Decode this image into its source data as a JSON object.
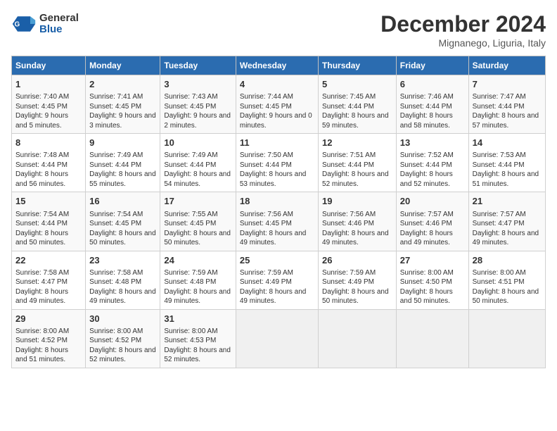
{
  "header": {
    "logo_line1": "General",
    "logo_line2": "Blue",
    "month": "December 2024",
    "location": "Mignanego, Liguria, Italy"
  },
  "days_of_week": [
    "Sunday",
    "Monday",
    "Tuesday",
    "Wednesday",
    "Thursday",
    "Friday",
    "Saturday"
  ],
  "weeks": [
    [
      {
        "day": "1",
        "rise": "Sunrise: 7:40 AM",
        "set": "Sunset: 4:45 PM",
        "daylight": "Daylight: 9 hours and 5 minutes."
      },
      {
        "day": "2",
        "rise": "Sunrise: 7:41 AM",
        "set": "Sunset: 4:45 PM",
        "daylight": "Daylight: 9 hours and 3 minutes."
      },
      {
        "day": "3",
        "rise": "Sunrise: 7:43 AM",
        "set": "Sunset: 4:45 PM",
        "daylight": "Daylight: 9 hours and 2 minutes."
      },
      {
        "day": "4",
        "rise": "Sunrise: 7:44 AM",
        "set": "Sunset: 4:45 PM",
        "daylight": "Daylight: 9 hours and 0 minutes."
      },
      {
        "day": "5",
        "rise": "Sunrise: 7:45 AM",
        "set": "Sunset: 4:44 PM",
        "daylight": "Daylight: 8 hours and 59 minutes."
      },
      {
        "day": "6",
        "rise": "Sunrise: 7:46 AM",
        "set": "Sunset: 4:44 PM",
        "daylight": "Daylight: 8 hours and 58 minutes."
      },
      {
        "day": "7",
        "rise": "Sunrise: 7:47 AM",
        "set": "Sunset: 4:44 PM",
        "daylight": "Daylight: 8 hours and 57 minutes."
      }
    ],
    [
      {
        "day": "8",
        "rise": "Sunrise: 7:48 AM",
        "set": "Sunset: 4:44 PM",
        "daylight": "Daylight: 8 hours and 56 minutes."
      },
      {
        "day": "9",
        "rise": "Sunrise: 7:49 AM",
        "set": "Sunset: 4:44 PM",
        "daylight": "Daylight: 8 hours and 55 minutes."
      },
      {
        "day": "10",
        "rise": "Sunrise: 7:49 AM",
        "set": "Sunset: 4:44 PM",
        "daylight": "Daylight: 8 hours and 54 minutes."
      },
      {
        "day": "11",
        "rise": "Sunrise: 7:50 AM",
        "set": "Sunset: 4:44 PM",
        "daylight": "Daylight: 8 hours and 53 minutes."
      },
      {
        "day": "12",
        "rise": "Sunrise: 7:51 AM",
        "set": "Sunset: 4:44 PM",
        "daylight": "Daylight: 8 hours and 52 minutes."
      },
      {
        "day": "13",
        "rise": "Sunrise: 7:52 AM",
        "set": "Sunset: 4:44 PM",
        "daylight": "Daylight: 8 hours and 52 minutes."
      },
      {
        "day": "14",
        "rise": "Sunrise: 7:53 AM",
        "set": "Sunset: 4:44 PM",
        "daylight": "Daylight: 8 hours and 51 minutes."
      }
    ],
    [
      {
        "day": "15",
        "rise": "Sunrise: 7:54 AM",
        "set": "Sunset: 4:44 PM",
        "daylight": "Daylight: 8 hours and 50 minutes."
      },
      {
        "day": "16",
        "rise": "Sunrise: 7:54 AM",
        "set": "Sunset: 4:45 PM",
        "daylight": "Daylight: 8 hours and 50 minutes."
      },
      {
        "day": "17",
        "rise": "Sunrise: 7:55 AM",
        "set": "Sunset: 4:45 PM",
        "daylight": "Daylight: 8 hours and 50 minutes."
      },
      {
        "day": "18",
        "rise": "Sunrise: 7:56 AM",
        "set": "Sunset: 4:45 PM",
        "daylight": "Daylight: 8 hours and 49 minutes."
      },
      {
        "day": "19",
        "rise": "Sunrise: 7:56 AM",
        "set": "Sunset: 4:46 PM",
        "daylight": "Daylight: 8 hours and 49 minutes."
      },
      {
        "day": "20",
        "rise": "Sunrise: 7:57 AM",
        "set": "Sunset: 4:46 PM",
        "daylight": "Daylight: 8 hours and 49 minutes."
      },
      {
        "day": "21",
        "rise": "Sunrise: 7:57 AM",
        "set": "Sunset: 4:47 PM",
        "daylight": "Daylight: 8 hours and 49 minutes."
      }
    ],
    [
      {
        "day": "22",
        "rise": "Sunrise: 7:58 AM",
        "set": "Sunset: 4:47 PM",
        "daylight": "Daylight: 8 hours and 49 minutes."
      },
      {
        "day": "23",
        "rise": "Sunrise: 7:58 AM",
        "set": "Sunset: 4:48 PM",
        "daylight": "Daylight: 8 hours and 49 minutes."
      },
      {
        "day": "24",
        "rise": "Sunrise: 7:59 AM",
        "set": "Sunset: 4:48 PM",
        "daylight": "Daylight: 8 hours and 49 minutes."
      },
      {
        "day": "25",
        "rise": "Sunrise: 7:59 AM",
        "set": "Sunset: 4:49 PM",
        "daylight": "Daylight: 8 hours and 49 minutes."
      },
      {
        "day": "26",
        "rise": "Sunrise: 7:59 AM",
        "set": "Sunset: 4:49 PM",
        "daylight": "Daylight: 8 hours and 50 minutes."
      },
      {
        "day": "27",
        "rise": "Sunrise: 8:00 AM",
        "set": "Sunset: 4:50 PM",
        "daylight": "Daylight: 8 hours and 50 minutes."
      },
      {
        "day": "28",
        "rise": "Sunrise: 8:00 AM",
        "set": "Sunset: 4:51 PM",
        "daylight": "Daylight: 8 hours and 50 minutes."
      }
    ],
    [
      {
        "day": "29",
        "rise": "Sunrise: 8:00 AM",
        "set": "Sunset: 4:52 PM",
        "daylight": "Daylight: 8 hours and 51 minutes."
      },
      {
        "day": "30",
        "rise": "Sunrise: 8:00 AM",
        "set": "Sunset: 4:52 PM",
        "daylight": "Daylight: 8 hours and 52 minutes."
      },
      {
        "day": "31",
        "rise": "Sunrise: 8:00 AM",
        "set": "Sunset: 4:53 PM",
        "daylight": "Daylight: 8 hours and 52 minutes."
      },
      null,
      null,
      null,
      null
    ]
  ]
}
